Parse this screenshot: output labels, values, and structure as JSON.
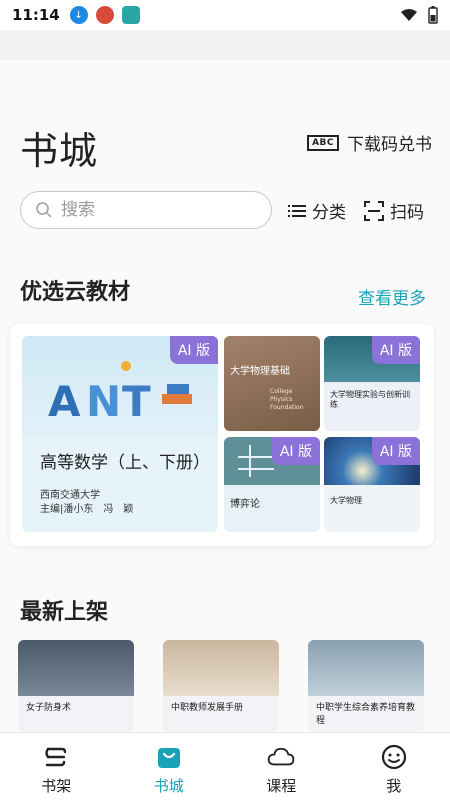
{
  "status_bar": {
    "time": "11:14"
  },
  "header": {
    "title": "书城",
    "redeem_label": "下载码兑书",
    "redeem_icon_text": "ABC"
  },
  "search": {
    "placeholder": "搜索"
  },
  "toolbar": {
    "category_label": "分类",
    "scan_label": "扫码"
  },
  "sections": {
    "featured_title": "优选云教材",
    "more_label": "查看更多",
    "new_title": "最新上架"
  },
  "featured": {
    "main": {
      "badge": "AI 版",
      "title": "高等数学（上、下册）",
      "publisher": "西南交通大学",
      "authors": "主编|潘小东　冯　颖"
    },
    "items": [
      {
        "badge": "",
        "cover_title": "大学物理基础",
        "cover_en": "College Physics Foundation"
      },
      {
        "badge": "AI 版",
        "title": "大学物理实验与创新训练"
      },
      {
        "badge": "AI 版",
        "title": "博弈论"
      },
      {
        "badge": "AI 版",
        "title": "大学物理"
      }
    ]
  },
  "new_books": [
    {
      "title": "女子防身术"
    },
    {
      "title": "中职教师发展手册"
    },
    {
      "title": "中职学生综合素养培育教程"
    }
  ],
  "tabs": [
    {
      "label": "书架",
      "icon": "bookshelf-icon"
    },
    {
      "label": "书城",
      "icon": "bookstore-icon",
      "active": true
    },
    {
      "label": "课程",
      "icon": "cloud-icon"
    },
    {
      "label": "我",
      "icon": "smile-icon"
    }
  ],
  "colors": {
    "accent": "#1aa3b8",
    "ai_badge": "#8a72d8"
  }
}
